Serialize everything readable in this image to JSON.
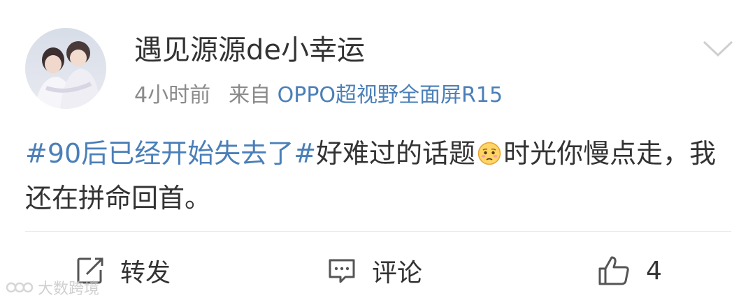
{
  "post": {
    "username": "遇见源源de小幸运",
    "time": "4小时前",
    "source_prefix": "来自",
    "source_device": "OPPO超视野全面屏R15",
    "topic": "#90后已经开始失去了#",
    "text_a": "好难过的话题",
    "emoji": "sad-face-emoji",
    "text_b": "时光你慢点走，我还在拼命回首。"
  },
  "actions": {
    "repost_label": "转发",
    "comment_label": "评论",
    "like_count": "4"
  },
  "watermark": {
    "text": "大数跨境"
  },
  "colors": {
    "link": "#4a7fb8",
    "text": "#333333",
    "meta": "#8a8a8a"
  }
}
